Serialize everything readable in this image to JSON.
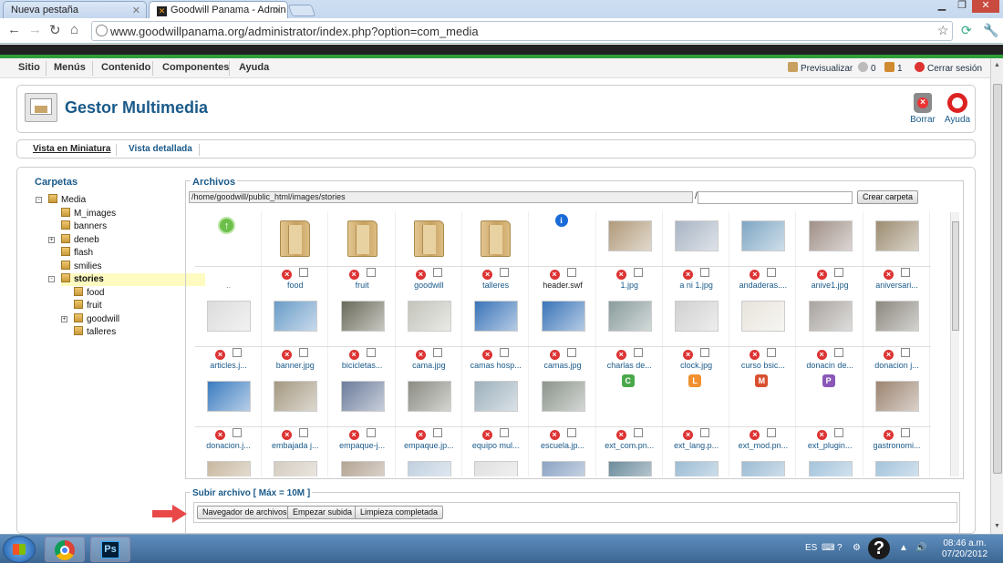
{
  "browser": {
    "tabs": [
      {
        "label": "Nueva pestaña"
      },
      {
        "label": "Goodwill Panama - Admin"
      }
    ],
    "url": "www.goodwillpanama.org/administrator/index.php?option=com_media"
  },
  "menu": {
    "items": [
      "Sitio",
      "Menús",
      "Contenido",
      "Componentes",
      "Ayuda"
    ],
    "right": {
      "preview": "Previsualizar",
      "messages_count": "0",
      "users_count": "1",
      "logout": "Cerrar sesión"
    }
  },
  "header": {
    "title": "Gestor Multimedia",
    "delete_label": "Borrar",
    "help_label": "Ayuda"
  },
  "views": {
    "thumbnail": "Vista en Miniatura",
    "detailed": "Vista detallada"
  },
  "folders": {
    "title": "Carpetas",
    "tree": [
      {
        "name": "Media",
        "depth": 0,
        "toggle": "-",
        "selected": false
      },
      {
        "name": "M_images",
        "depth": 1,
        "toggle": "",
        "selected": false
      },
      {
        "name": "banners",
        "depth": 1,
        "toggle": "",
        "selected": false
      },
      {
        "name": "deneb",
        "depth": 1,
        "toggle": "+",
        "selected": false
      },
      {
        "name": "flash",
        "depth": 1,
        "toggle": "",
        "selected": false
      },
      {
        "name": "smilies",
        "depth": 1,
        "toggle": "",
        "selected": false
      },
      {
        "name": "stories",
        "depth": 1,
        "toggle": "-",
        "selected": true
      },
      {
        "name": "food",
        "depth": 2,
        "toggle": "",
        "selected": false
      },
      {
        "name": "fruit",
        "depth": 2,
        "toggle": "",
        "selected": false
      },
      {
        "name": "goodwill",
        "depth": 2,
        "toggle": "+",
        "selected": false
      },
      {
        "name": "talleres",
        "depth": 2,
        "toggle": "",
        "selected": false
      }
    ]
  },
  "files": {
    "title": "Archivos",
    "path": "/home/goodwill/public_html/images/stories",
    "path_separator": "/",
    "create_folder": "Crear carpeta",
    "items": [
      {
        "label": "..",
        "kind": "up"
      },
      {
        "label": "food",
        "kind": "folder"
      },
      {
        "label": "fruit",
        "kind": "folder"
      },
      {
        "label": "goodwill",
        "kind": "folder"
      },
      {
        "label": "talleres",
        "kind": "folder"
      },
      {
        "label": "header.swf",
        "kind": "info"
      },
      {
        "label": "1.jpg",
        "kind": "image",
        "color": "#b09a7a"
      },
      {
        "label": "a ni 1.jpg",
        "kind": "image",
        "color": "#a8b4c4"
      },
      {
        "label": "andaderas....",
        "kind": "image",
        "color": "#7ea6c4"
      },
      {
        "label": "anive1.jpg",
        "kind": "image",
        "color": "#a09088"
      },
      {
        "label": "aniversari...",
        "kind": "image",
        "color": "#9c8c70"
      },
      {
        "label": "articles.j...",
        "kind": "image",
        "color": "#dcdcdc"
      },
      {
        "label": "banner.jpg",
        "kind": "image",
        "color": "#6a9cc8"
      },
      {
        "label": "bicicletas...",
        "kind": "image",
        "color": "#6a6a5a"
      },
      {
        "label": "cama.jpg",
        "kind": "image",
        "color": "#c4c4bc"
      },
      {
        "label": "camas hosp...",
        "kind": "image",
        "color": "#3a74b8"
      },
      {
        "label": "camas.jpg",
        "kind": "image",
        "color": "#3a74b8"
      },
      {
        "label": "charlas de...",
        "kind": "image",
        "color": "#8a9c9c"
      },
      {
        "label": "clock.jpg",
        "kind": "image",
        "color": "#d0d0d0"
      },
      {
        "label": "curso bsic...",
        "kind": "image",
        "color": "#e8e4dc"
      },
      {
        "label": "donacin de...",
        "kind": "image",
        "color": "#a8a4a0"
      },
      {
        "label": "donacion j...",
        "kind": "image",
        "color": "#8c8880"
      },
      {
        "label": "donacion.j...",
        "kind": "image",
        "color": "#3c7cc0"
      },
      {
        "label": "embajada j...",
        "kind": "image",
        "color": "#a49880"
      },
      {
        "label": "empaque-j...",
        "kind": "image",
        "color": "#6c7c9c"
      },
      {
        "label": "empaque.jp...",
        "kind": "image",
        "color": "#8c8c84"
      },
      {
        "label": "equipo mul...",
        "kind": "image",
        "color": "#9cb0bc"
      },
      {
        "label": "escuela.jp...",
        "kind": "image",
        "color": "#8c948c"
      },
      {
        "label": "ext_com.pn...",
        "kind": "ext",
        "letter": "C",
        "color": "#4aa84a"
      },
      {
        "label": "ext_lang.p...",
        "kind": "ext",
        "letter": "L",
        "color": "#f09030"
      },
      {
        "label": "ext_mod.pn...",
        "kind": "ext",
        "letter": "M",
        "color": "#d85030"
      },
      {
        "label": "ext_plugin...",
        "kind": "ext",
        "letter": "P",
        "color": "#8a58b8"
      },
      {
        "label": "gastronomi...",
        "kind": "image",
        "color": "#9c8470"
      },
      {
        "label": "",
        "kind": "image",
        "color": "#c8b8a0"
      },
      {
        "label": "",
        "kind": "image",
        "color": "#d4ccc0"
      },
      {
        "label": "",
        "kind": "image",
        "color": "#b4a494"
      },
      {
        "label": "",
        "kind": "image",
        "color": "#c0d0e0"
      },
      {
        "label": "",
        "kind": "image",
        "color": "#e0e0e0"
      },
      {
        "label": "",
        "kind": "image",
        "color": "#8ca4c4"
      },
      {
        "label": "",
        "kind": "image",
        "color": "#6c8c9c"
      },
      {
        "label": "",
        "kind": "image",
        "color": "#9cbcd4"
      },
      {
        "label": "",
        "kind": "image",
        "color": "#9cbcd4"
      },
      {
        "label": "",
        "kind": "image",
        "color": "#a4c4dc"
      },
      {
        "label": "",
        "kind": "image",
        "color": "#a4c4dc"
      }
    ]
  },
  "upload": {
    "title": "Subir archivo [ Máx = 10M ]",
    "browse": "Navegador de archivos",
    "start": "Empezar subida",
    "clear": "Limpieza completada"
  },
  "taskbar": {
    "language": "ES",
    "time": "08:46 a.m.",
    "date": "07/20/2012"
  }
}
